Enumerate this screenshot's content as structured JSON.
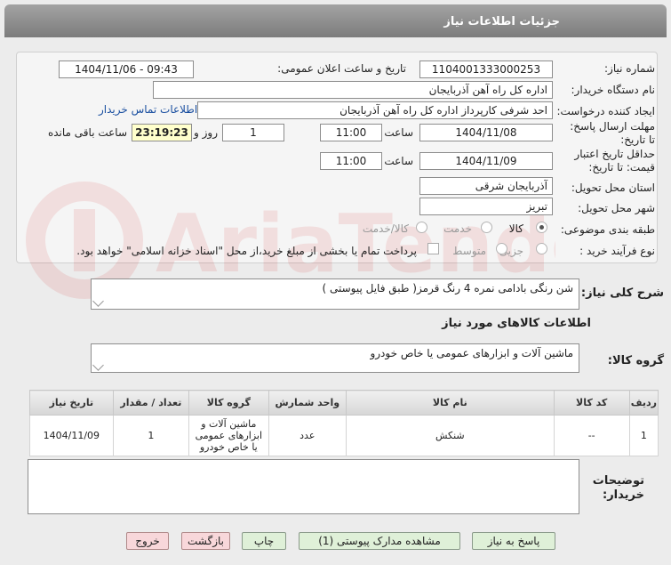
{
  "header": {
    "title": "جزئیات اطلاعات نیاز"
  },
  "form": {
    "need_number_label": "شماره نیاز:",
    "need_number": "1104001333000253",
    "announce_label": "تاریخ و ساعت اعلان عمومی:",
    "announce_value": "1404/11/06 - 09:43",
    "buyer_label": "نام دستگاه خریدار:",
    "buyer_value": "اداره کل راه آهن آذربایجان",
    "creator_label": "ایجاد کننده درخواست:",
    "creator_value": "احد شرفی کارپرداز اداره کل راه آهن آذربایجان",
    "contact_link": "اطلاعات تماس خریدار",
    "deadline_label": "مهلت ارسال پاسخ: تا تاریخ:",
    "deadline_date": "1404/11/08",
    "time_label": "ساعت",
    "deadline_time": "11:00",
    "days_value": "1",
    "days_label": "روز و",
    "remaining_value": "23:19:23",
    "remaining_label": "ساعت باقی مانده",
    "validity_label": "حداقل تاریخ اعتبار قیمت: تا تاریخ:",
    "validity_date": "1404/11/09",
    "validity_time": "11:00",
    "province_label": "استان محل تحویل:",
    "province_value": "آذربایجان شرقی",
    "city_label": "شهر محل تحویل:",
    "city_value": "تبریز",
    "category_label": "طبقه بندی موضوعی:",
    "category_options": [
      "کالا",
      "خدمت",
      "کالا/خدمت"
    ],
    "category_selected": "کالا",
    "process_label": "نوع فرآیند خرید :",
    "process_options": [
      "جزیی",
      "متوسط"
    ],
    "payment_note": "پرداخت تمام یا بخشی از مبلغ خرید،از محل \"اسناد خزانه اسلامی\" خواهد بود."
  },
  "description": {
    "label": "شرح کلی نیاز:",
    "value": "شن رنگی بادامی نمره 4 رنگ قرمز( طبق فایل پیوستی )"
  },
  "goods_section_title": "اطلاعات کالاهای مورد نیاز",
  "goods_group": {
    "label": "گروه کالا:",
    "value": "ماشین آلات و ابزارهای عمومی یا خاص خودرو"
  },
  "table": {
    "headers": [
      "ردیف",
      "کد کالا",
      "نام کالا",
      "واحد شمارش",
      "گروه کالا",
      "تعداد / مقدار",
      "تاریخ نیاز"
    ],
    "rows": [
      [
        "1",
        "--",
        "شنکش",
        "عدد",
        "ماشین آلات و ابزارهای عمومی یا خاص خودرو",
        "1",
        "1404/11/09"
      ]
    ]
  },
  "buyer_notes": {
    "label": "توضیحات خریدار:",
    "value": ""
  },
  "buttons": {
    "reply": "پاسخ به نیاز",
    "attachments": "مشاهده مدارک پیوستی (1)",
    "print": "چاپ",
    "back": "بازگشت",
    "exit": "خروج"
  },
  "watermark": "AriaTender.neT",
  "colors": {
    "header_bg": "#8c8c8c",
    "link": "#1a4fa0",
    "button_green": "#dff0d8",
    "button_red": "#f8d7da",
    "countdown_bg": "#ffffcc"
  }
}
